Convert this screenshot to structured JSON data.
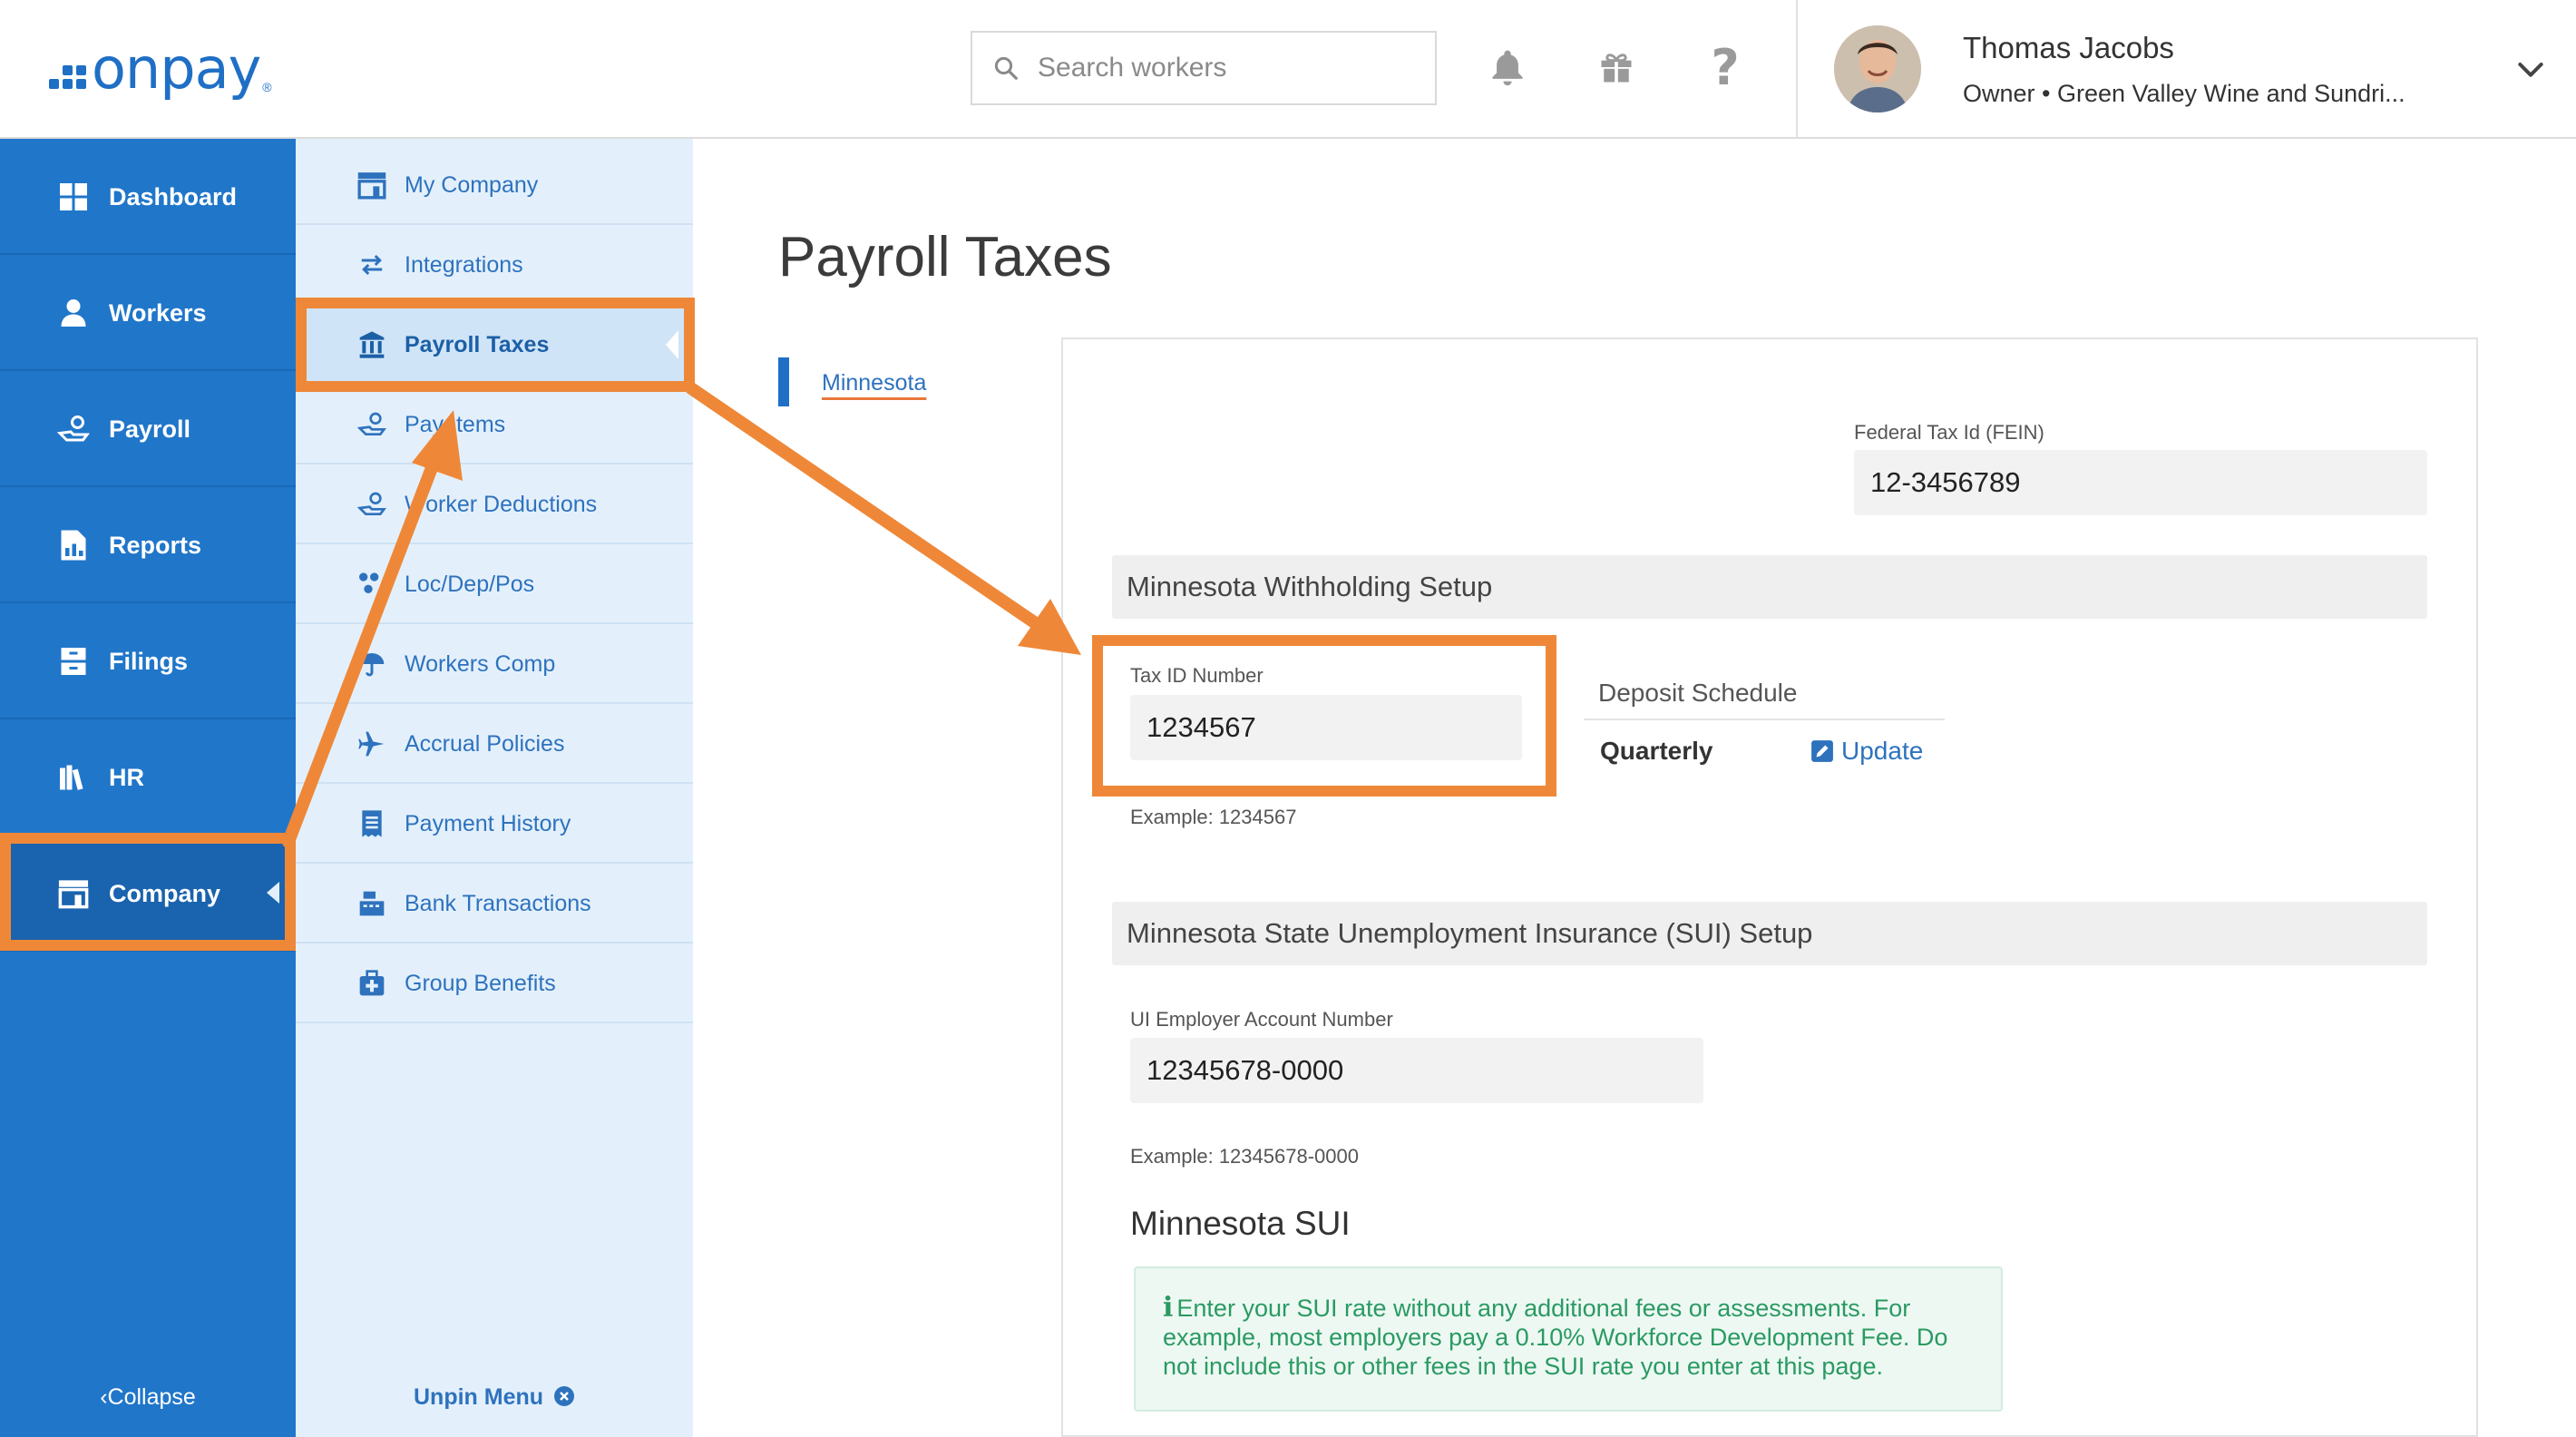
{
  "header": {
    "logo": "onpay",
    "search_placeholder": "Search workers",
    "user_name": "Thomas Jacobs",
    "user_role": "Owner • Green Valley Wine and Sundri..."
  },
  "left_nav": {
    "items": [
      {
        "label": "Dashboard",
        "icon": "dashboard-icon"
      },
      {
        "label": "Workers",
        "icon": "workers-icon"
      },
      {
        "label": "Payroll",
        "icon": "payroll-icon"
      },
      {
        "label": "Reports",
        "icon": "reports-icon"
      },
      {
        "label": "Filings",
        "icon": "filings-icon"
      },
      {
        "label": "HR",
        "icon": "hr-icon"
      },
      {
        "label": "Company",
        "icon": "company-icon"
      }
    ],
    "active": "Company",
    "collapse_label": "Collapse"
  },
  "sub_nav": {
    "items": [
      {
        "label": "My Company",
        "icon": "storefront-icon"
      },
      {
        "label": "Integrations",
        "icon": "arrows-exchange-icon"
      },
      {
        "label": "Payroll Taxes",
        "icon": "bank-icon"
      },
      {
        "label": "Pay Items",
        "icon": "hand-money-icon"
      },
      {
        "label": "Worker Deductions",
        "icon": "hand-money-icon"
      },
      {
        "label": "Loc/Dep/Pos",
        "icon": "org-icon"
      },
      {
        "label": "Workers Comp",
        "icon": "umbrella-icon"
      },
      {
        "label": "Accrual Policies",
        "icon": "airplane-icon"
      },
      {
        "label": "Payment History",
        "icon": "receipt-icon"
      },
      {
        "label": "Bank Transactions",
        "icon": "cash-register-icon"
      },
      {
        "label": "Group Benefits",
        "icon": "medical-kit-icon"
      }
    ],
    "active": "Payroll Taxes",
    "unpin_label": "Unpin Menu"
  },
  "main": {
    "title": "Payroll Taxes",
    "state_tab": "Minnesota",
    "fein": {
      "label": "Federal Tax Id (FEIN)",
      "value": "12-3456789"
    },
    "withholding": {
      "title": "Minnesota Withholding Setup",
      "tax_id_label": "Tax ID Number",
      "tax_id_value": "1234567",
      "tax_id_example": "Example: 1234567",
      "deposit_label": "Deposit Schedule",
      "deposit_value": "Quarterly",
      "update_label": "Update"
    },
    "sui": {
      "title": "Minnesota State Unemployment Insurance (SUI) Setup",
      "account_label": "UI Employer Account Number",
      "account_value": "12345678-0000",
      "account_example": "Example: 12345678-0000",
      "heading": "Minnesota SUI",
      "info": "Enter your SUI rate without any additional fees or assessments. For example, most employers pay a 0.10% Workforce Development Fee. Do not include this or other fees in the SUI rate you enter at this page."
    }
  },
  "colors": {
    "brand_blue": "#2076c9",
    "highlight_orange": "#ee8838",
    "subnav_bg": "#e3f0fc",
    "info_green": "#2a9a62"
  }
}
